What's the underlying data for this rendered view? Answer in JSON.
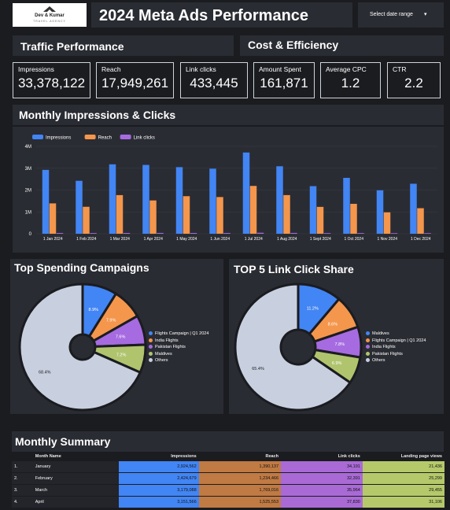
{
  "logo": {
    "brand": "Dev & Kumar",
    "tagline": "TRAVEL AGENCY"
  },
  "header": {
    "title": "2024 Meta Ads Performance",
    "date_range_label": "Select date range"
  },
  "traffic": {
    "title": "Traffic Performance"
  },
  "cost": {
    "title": "Cost & Efficiency"
  },
  "kpis": [
    {
      "label": "Impressions",
      "value": "33,378,122"
    },
    {
      "label": "Reach",
      "value": "17,949,261"
    },
    {
      "label": "Link clicks",
      "value": "433,445"
    },
    {
      "label": "Amount Spent",
      "value": "161,871"
    },
    {
      "label": "Average CPC",
      "value": "1.2"
    },
    {
      "label": "CTR",
      "value": "2.2"
    }
  ],
  "monthly_chart": {
    "title": "Monthly Impressions & Clicks"
  },
  "spending": {
    "title": "Top Spending Campaigns"
  },
  "share": {
    "title": "TOP 5 Link Click Share"
  },
  "summary": {
    "title": "Monthly Summary",
    "columns": [
      "Month Name",
      "Impressions",
      "Reach",
      "Link clicks",
      "Landing page views"
    ],
    "rows": [
      {
        "idx": "1.",
        "month": "January",
        "impressions": "2,924,562",
        "reach": "1,390,137",
        "clicks": "34,191",
        "landing": "21,436"
      },
      {
        "idx": "2.",
        "month": "February",
        "impressions": "2,424,679",
        "reach": "1,234,466",
        "clicks": "32,391",
        "landing": "25,299"
      },
      {
        "idx": "3.",
        "month": "March",
        "impressions": "3,179,088",
        "reach": "1,769,016",
        "clicks": "35,964",
        "landing": "29,455"
      },
      {
        "idx": "4.",
        "month": "April",
        "impressions": "3,151,566",
        "reach": "1,525,553",
        "clicks": "37,830",
        "landing": "31,106"
      }
    ]
  },
  "colors": {
    "impressions": "#4285f4",
    "reach": "#f4964c",
    "link_clicks": "#a66be0",
    "maldives": "#b0c46e",
    "others": "#c8d0e0"
  },
  "chart_data": [
    {
      "type": "bar",
      "title": "Monthly Impressions & Clicks",
      "categories": [
        "1 Jan 2024",
        "1 Feb 2024",
        "1 Mar 2024",
        "1 Apr 2024",
        "1 May 2024",
        "1 Jun 2024",
        "1 Jul 2024",
        "1 Aug 2024",
        "1 Sept 2024",
        "1 Oct 2024",
        "1 Nov 2024",
        "1 Dec 2024"
      ],
      "series": [
        {
          "name": "Impressions",
          "values": [
            2924562,
            2424679,
            3179088,
            3151566,
            3050000,
            2980000,
            3720000,
            3090000,
            2180000,
            2560000,
            1990000,
            2290000
          ]
        },
        {
          "name": "Reach",
          "values": [
            1390137,
            1234466,
            1769016,
            1525553,
            1720000,
            1680000,
            2190000,
            1770000,
            1230000,
            1370000,
            980000,
            1170000
          ]
        },
        {
          "name": "Link clicks",
          "values": [
            34191,
            32391,
            35964,
            37830,
            36000,
            35000,
            45000,
            38000,
            30000,
            32000,
            25000,
            28000
          ]
        }
      ],
      "yticks": [
        "0",
        "1M",
        "2M",
        "3M",
        "4M"
      ],
      "ylim": [
        0,
        4000000
      ],
      "legend": "top-left"
    },
    {
      "type": "pie",
      "title": "Top Spending Campaigns",
      "labels": [
        "Flights Campaign | Q1 2024",
        "India Flights",
        "Pakistan Flights",
        "Maldives",
        "Others"
      ],
      "values": [
        8.9,
        7.9,
        7.6,
        7.2,
        68.4
      ],
      "value_labels": [
        "8.9%",
        "7.9%",
        "7.6%",
        "7.2%",
        "68.4%"
      ],
      "colors": [
        "#4285f4",
        "#f4964c",
        "#a66be0",
        "#b0c46e",
        "#c8d0e0"
      ],
      "legend": "right"
    },
    {
      "type": "pie",
      "title": "TOP 5 Link Click Share",
      "labels": [
        "Maldives",
        "Flights Campaign | Q1 2024",
        "India Flights",
        "Pakistan Flights",
        "Others"
      ],
      "values": [
        11.2,
        8.6,
        7.8,
        6.9,
        65.4
      ],
      "value_labels": [
        "11.2%",
        "8.6%",
        "7.8%",
        "6.9%",
        "65.4%"
      ],
      "colors": [
        "#4285f4",
        "#f4964c",
        "#a66be0",
        "#b0c46e",
        "#c8d0e0"
      ],
      "legend": "right"
    }
  ]
}
